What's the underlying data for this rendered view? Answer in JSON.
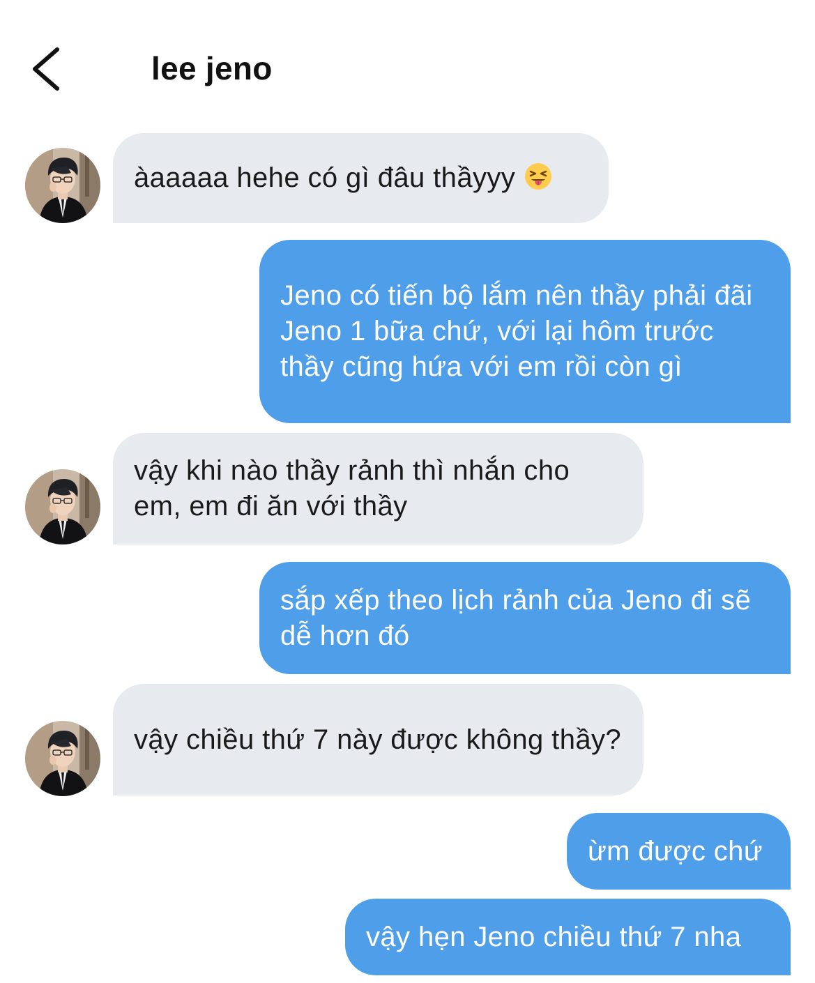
{
  "header": {
    "title": "lee jeno",
    "back_icon": "chevron-left-icon"
  },
  "colors": {
    "received_bubble": "#e7ebef",
    "sent_bubble": "#4e9ee9",
    "sent_text": "#ffffff",
    "received_text": "#1a1a1a"
  },
  "messages": [
    {
      "from": "contact",
      "text": "àaaaaa hehe có gì đâu thầyyy",
      "emoji": "squinting-face-with-tongue-icon"
    },
    {
      "from": "me",
      "text": "Jeno có tiến bộ lắm nên thầy phải đãi Jeno 1 bữa chứ, với lại hôm trước thầy cũng hứa với em rồi còn gì"
    },
    {
      "from": "contact",
      "text": "vậy khi nào thầy rảnh thì nhắn cho em, em đi ăn với thầy"
    },
    {
      "from": "me",
      "text": "sắp xếp theo lịch rảnh của Jeno đi sẽ dễ hơn đó"
    },
    {
      "from": "contact",
      "text": "vậy chiều thứ 7 này được không thầy?"
    },
    {
      "from": "me",
      "text": "ừm được chứ"
    },
    {
      "from": "me",
      "text": "vậy hẹn Jeno chiều thứ 7 nha"
    }
  ]
}
